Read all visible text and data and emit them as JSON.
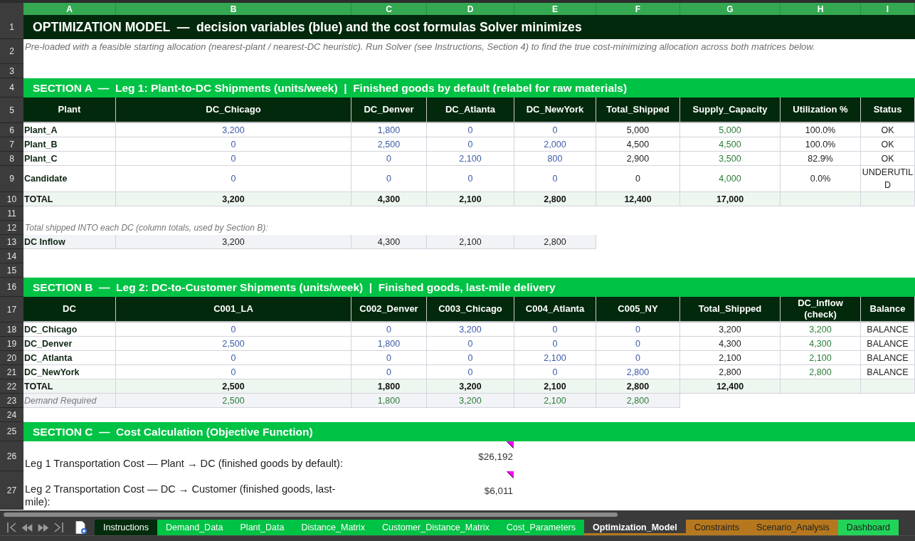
{
  "column_letters": [
    "A",
    "B",
    "C",
    "D",
    "E",
    "F",
    "G",
    "H",
    "I"
  ],
  "rows": [
    {
      "number": "1",
      "kind": "title",
      "text": "OPTIMIZATION MODEL  —  decision variables (blue) and the cost formulas Solver minimizes"
    },
    {
      "number": "2",
      "kind": "subtitle",
      "text": "Pre-loaded with a feasible starting allocation (nearest-plant / nearest-DC heuristic). Run Solver (see Instructions, Section 4) to find the true cost-minimizing allocation across both matrices below."
    },
    {
      "number": "3",
      "kind": "blank"
    },
    {
      "number": "4",
      "kind": "section",
      "text": "SECTION A  —  Leg 1: Plant-to-DC Shipments (units/week)  |  Finished goods by default (relabel for raw materials)"
    },
    {
      "number": "5",
      "kind": "header",
      "cells": [
        {
          "text": "Plant",
          "kind": "label"
        },
        {
          "text": "DC_Chicago",
          "kind": "variable"
        },
        {
          "text": "DC_Denver",
          "kind": "variable"
        },
        {
          "text": "DC_Atlanta",
          "kind": "variable"
        },
        {
          "text": "DC_NewYork",
          "kind": "variable"
        },
        {
          "text": "Total_Shipped",
          "kind": "formula"
        },
        {
          "text": "Supply_Capacity",
          "kind": "parameter"
        },
        {
          "text": "Utilization %",
          "kind": "formula"
        },
        {
          "text": "Status",
          "kind": "formula"
        }
      ]
    },
    {
      "number": "6",
      "kind": "data",
      "cells": [
        "Plant_A",
        "3,200",
        "1,800",
        "0",
        "0",
        "5,000",
        "5,000",
        "100.0%",
        "OK"
      ]
    },
    {
      "number": "7",
      "kind": "data",
      "cells": [
        "Plant_B",
        "0",
        "2,500",
        "0",
        "2,000",
        "4,500",
        "4,500",
        "100.0%",
        "OK"
      ]
    },
    {
      "number": "8",
      "kind": "data",
      "cells": [
        "Plant_C",
        "0",
        "0",
        "2,100",
        "800",
        "2,900",
        "3,500",
        "82.9%",
        "OK"
      ]
    },
    {
      "number": "9",
      "kind": "data",
      "cells": [
        "Candidate",
        "0",
        "0",
        "0",
        "0",
        "0",
        "4,000",
        "0.0%",
        "UNDERUTIL D"
      ]
    },
    {
      "number": "10",
      "kind": "total",
      "cells": [
        "TOTAL",
        "3,200",
        "4,300",
        "2,100",
        "2,800",
        "12,400",
        "17,000"
      ]
    },
    {
      "number": "11",
      "kind": "blank"
    },
    {
      "number": "12",
      "kind": "note",
      "text": "Total shipped INTO each DC (column totals, used by Section B):"
    },
    {
      "number": "13",
      "kind": "inflow",
      "cells": [
        "DC Inflow",
        "3,200",
        "4,300",
        "2,100",
        "2,800"
      ]
    },
    {
      "number": "14",
      "kind": "blank"
    },
    {
      "number": "15",
      "kind": "blank"
    },
    {
      "number": "16",
      "kind": "section",
      "text": "SECTION B  —  Leg 2: DC-to-Customer Shipments (units/week)  |  Finished goods, last-mile delivery"
    },
    {
      "number": "17",
      "kind": "header",
      "cells": [
        {
          "text": "DC",
          "kind": "label"
        },
        {
          "text": "C001_LA",
          "kind": "variable"
        },
        {
          "text": "C002_Denver",
          "kind": "variable"
        },
        {
          "text": "C003_Chicago",
          "kind": "variable"
        },
        {
          "text": "C004_Atlanta",
          "kind": "variable"
        },
        {
          "text": "C005_NY",
          "kind": "variable"
        },
        {
          "text": "Total_Shipped",
          "kind": "formula"
        },
        {
          "text": "DC_Inflow (check)",
          "kind": "parameter"
        },
        {
          "text": "Balance",
          "kind": "formula"
        }
      ]
    },
    {
      "number": "18",
      "kind": "data",
      "cells": [
        "DC_Chicago",
        "0",
        "0",
        "3,200",
        "0",
        "0",
        "3,200",
        "3,200",
        "BALANCE"
      ]
    },
    {
      "number": "19",
      "kind": "data",
      "cells": [
        "DC_Denver",
        "2,500",
        "1,800",
        "0",
        "0",
        "0",
        "4,300",
        "4,300",
        "BALANCE"
      ]
    },
    {
      "number": "20",
      "kind": "data",
      "cells": [
        "DC_Atlanta",
        "0",
        "0",
        "0",
        "2,100",
        "0",
        "2,100",
        "2,100",
        "BALANCE"
      ]
    },
    {
      "number": "21",
      "kind": "data",
      "cells": [
        "DC_NewYork",
        "0",
        "0",
        "0",
        "0",
        "2,800",
        "2,800",
        "2,800",
        "BALANCE"
      ]
    },
    {
      "number": "22",
      "kind": "total",
      "cells": [
        "TOTAL",
        "2,500",
        "1,800",
        "3,200",
        "2,100",
        "2,800",
        "12,400"
      ]
    },
    {
      "number": "23",
      "kind": "demand",
      "cells": [
        "Demand Required",
        "2,500",
        "1,800",
        "3,200",
        "2,100",
        "2,800"
      ]
    },
    {
      "number": "24",
      "kind": "blank"
    },
    {
      "number": "25",
      "kind": "section",
      "text": "SECTION C  —  Cost Calculation (Objective Function)"
    },
    {
      "number": "26",
      "kind": "cost",
      "label": "Leg 1 Transportation Cost — Plant → DC (finished goods by default):",
      "value": "$26,192",
      "comment": true
    },
    {
      "number": "27",
      "kind": "cost",
      "label": "Leg 2 Transportation Cost — DC → Customer (finished goods, last-mile):",
      "value": "$6,011",
      "comment": true
    }
  ],
  "tabs": [
    {
      "label": "Instructions",
      "color": "#022c0c",
      "selected": false
    },
    {
      "label": "Demand_Data",
      "color": "#00c244",
      "selected": false
    },
    {
      "label": "Plant_Data",
      "color": "#00c244",
      "selected": false
    },
    {
      "label": "Distance_Matrix",
      "color": "#00c244",
      "selected": false
    },
    {
      "label": "Customer_Distance_Matrix",
      "color": "#00c244",
      "selected": false
    },
    {
      "label": "Cost_Parameters",
      "color": "#00c244",
      "selected": false
    },
    {
      "label": "Optimization_Model",
      "color": "#b5781f",
      "selected": true
    },
    {
      "label": "Constraints",
      "color": "#b5781f",
      "selected": false
    },
    {
      "label": "Scenario_Analysis",
      "color": "#b5781f",
      "selected": false
    },
    {
      "label": "Dashboard",
      "color": "#22d35a",
      "selected": false
    }
  ]
}
